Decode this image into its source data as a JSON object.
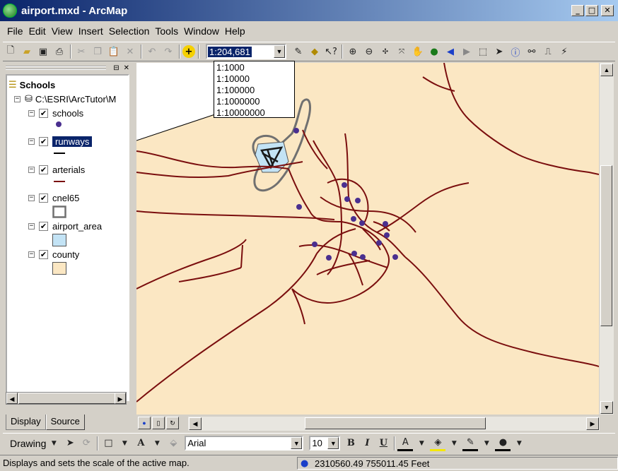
{
  "window": {
    "title": "airport.mxd - ArcMap",
    "minimize": "_",
    "maximize": "□",
    "close": "✕"
  },
  "menu": [
    "File",
    "Edit",
    "View",
    "Insert",
    "Selection",
    "Tools",
    "Window",
    "Help"
  ],
  "scale": {
    "value": "1:204,681",
    "options": [
      "1:1000",
      "1:10000",
      "1:100000",
      "1:1000000",
      "1:10000000"
    ]
  },
  "toc": {
    "root": "Schools",
    "source": "C:\\ESRI\\ArcTutor\\M",
    "layers": [
      {
        "name": "schools",
        "checked": true,
        "selected": false
      },
      {
        "name": "runways",
        "checked": true,
        "selected": true
      },
      {
        "name": "arterials",
        "checked": true,
        "selected": false
      },
      {
        "name": "cnel65",
        "checked": true,
        "selected": false
      },
      {
        "name": "airport_area",
        "checked": true,
        "selected": false
      },
      {
        "name": "county",
        "checked": true,
        "selected": false
      }
    ],
    "tabs": [
      "Display",
      "Source"
    ],
    "active_tab": "Source"
  },
  "colors": {
    "county": "#fbe7c3",
    "arterials": "#7a0e0e",
    "schools": "#4a2f8f",
    "airport_area": "#c3e3f5",
    "cnel65": "#707070",
    "runways": "#1a1a1a"
  },
  "drawing": {
    "label": "Drawing",
    "font": "Arial",
    "font_size": "10",
    "bold": "B",
    "italic": "I",
    "underline": "U",
    "text_tool": "A"
  },
  "status": {
    "message": "Displays and sets the scale of the active map.",
    "coordinates": "2310560.49  755011.45 Feet"
  }
}
